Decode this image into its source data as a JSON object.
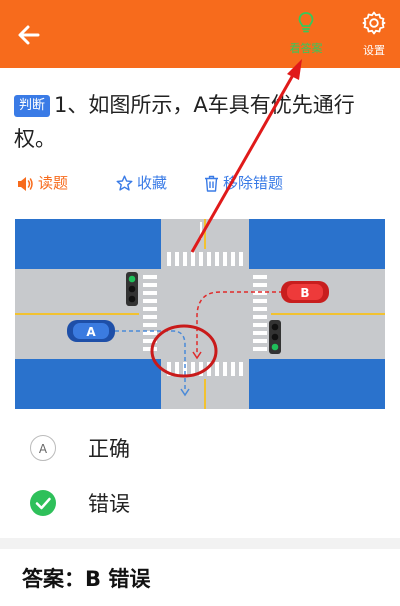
{
  "header": {
    "back_icon": "arrow-left-icon",
    "answer_label": "看答案",
    "answer_icon": "lightbulb-icon",
    "settings_label": "设置",
    "settings_icon": "gear-icon",
    "background_color": "#f76b1c",
    "answer_color": "#35c95b"
  },
  "question": {
    "type_badge": "判断",
    "text": "1、如图所示，A车具有优先通行权。"
  },
  "actions": {
    "read_label": "读题",
    "read_icon": "speaker-icon",
    "favorite_label": "收藏",
    "favorite_icon": "star-icon",
    "remove_label": "移除错题",
    "remove_icon": "trash-icon"
  },
  "illustration": {
    "car_a_label": "A",
    "car_b_label": "B"
  },
  "options": [
    {
      "marker": "A",
      "text": "正确",
      "selected": false
    },
    {
      "marker": "check-icon",
      "text": "错误",
      "selected": true
    }
  ],
  "answer": {
    "text": "答案：B 错误"
  },
  "colors": {
    "accent_orange": "#f76b1c",
    "link_blue": "#3a7be6",
    "correct_green": "#2ec05a",
    "annotation_red": "#e01a1a"
  }
}
